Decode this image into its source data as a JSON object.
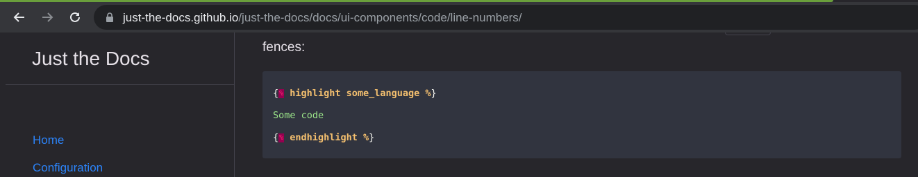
{
  "browser": {
    "url_host": "just-the-docs.github.io",
    "url_path": "/just-the-docs/docs/ui-components/code/line-numbers/"
  },
  "sidebar": {
    "site_title": "Just the Docs",
    "nav": [
      {
        "label": "Home"
      },
      {
        "label": "Configuration"
      }
    ]
  },
  "main": {
    "paragraph_tail": "fences:",
    "code": {
      "line1": {
        "open": "{",
        "tag_marker": "%",
        "text": " highlight some_language %",
        "close": "}"
      },
      "line2": {
        "text": "Some code"
      },
      "line3": {
        "open": "{",
        "tag_marker": "%",
        "text": " endhighlight %",
        "close": "}"
      }
    }
  },
  "colors": {
    "accent_link": "#2c84fa",
    "code_background": "#31343f",
    "code_keyword": "#f5c06f",
    "code_plain": "#9ce68a"
  }
}
